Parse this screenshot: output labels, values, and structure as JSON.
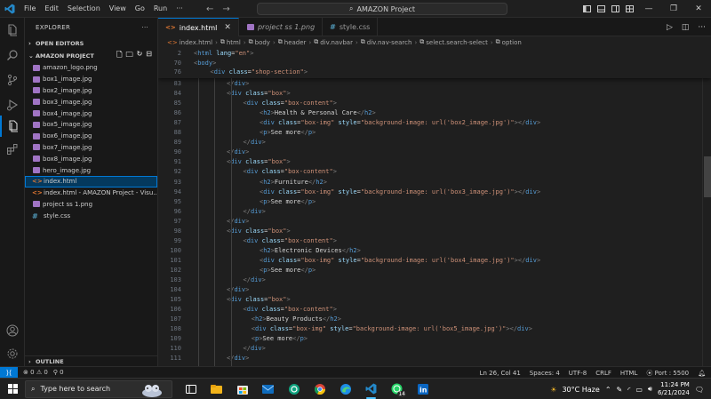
{
  "menu": [
    "File",
    "Edit",
    "Selection",
    "View",
    "Go",
    "Run",
    "···"
  ],
  "command_center": "AMAZON Project",
  "explorer": {
    "title": "EXPLORER",
    "open_editors": "OPEN EDITORS",
    "project": "AMAZON PROJECT",
    "files": [
      {
        "name": "amazon_logo.png",
        "type": "img"
      },
      {
        "name": "box1_image.jpg",
        "type": "img"
      },
      {
        "name": "box2_image.jpg",
        "type": "img"
      },
      {
        "name": "box3_image.jpg",
        "type": "img"
      },
      {
        "name": "box4_image.jpg",
        "type": "img"
      },
      {
        "name": "box5_image.jpg",
        "type": "img"
      },
      {
        "name": "box6_image.jpg",
        "type": "img"
      },
      {
        "name": "box7_image.jpg",
        "type": "img"
      },
      {
        "name": "box8_image.jpg",
        "type": "img"
      },
      {
        "name": "hero_image.jpg",
        "type": "img"
      },
      {
        "name": "index.html",
        "type": "html",
        "selected": true
      },
      {
        "name": "index.html - AMAZON Project - Visu...",
        "type": "html"
      },
      {
        "name": "project ss 1.png",
        "type": "img"
      },
      {
        "name": "style.css",
        "type": "css"
      }
    ],
    "outline": "OUTLINE"
  },
  "tabs": [
    {
      "label": "index.html",
      "active": true,
      "icon": "html"
    },
    {
      "label": "project ss 1.png",
      "active": false,
      "icon": "img"
    },
    {
      "label": "style.css",
      "active": false,
      "icon": "css"
    }
  ],
  "breadcrumb": [
    "index.html",
    "html",
    "body",
    "header",
    "div.navbar",
    "div.nav-search",
    "select.search-select",
    "option"
  ],
  "sticky_lines": [
    {
      "n": "2",
      "indent": 0,
      "html": "<span class='brk'>&lt;</span><span class='tag'>html</span> <span class='attr'>lang</span><span class='txt'>=</span><span class='str'>\"en\"</span><span class='brk'>&gt;</span>"
    },
    {
      "n": "70",
      "indent": 0,
      "html": "<span class='brk'>&lt;</span><span class='tag'>body</span><span class='brk'>&gt;</span>"
    },
    {
      "n": "76",
      "indent": 1,
      "html": "<span class='brk'>&lt;</span><span class='tag'>div</span> <span class='attr'>class</span><span class='txt'>=</span><span class='str'>\"shop-section\"</span><span class='brk'>&gt;</span>"
    }
  ],
  "code_lines": [
    {
      "n": "83",
      "indent": 2,
      "html": "<span class='brk'>&lt;/</span><span class='tag'>div</span><span class='brk'>&gt;</span>"
    },
    {
      "n": "84",
      "indent": 2,
      "html": "<span class='brk'>&lt;</span><span class='tag'>div</span> <span class='attr'>class</span><span class='txt'>=</span><span class='str'>\"box\"</span><span class='brk'>&gt;</span>"
    },
    {
      "n": "85",
      "indent": 3,
      "html": "<span class='brk'>&lt;</span><span class='tag'>div</span> <span class='attr'>class</span><span class='txt'>=</span><span class='str'>\"box-content\"</span><span class='brk'>&gt;</span>"
    },
    {
      "n": "86",
      "indent": 4,
      "html": "<span class='brk'>&lt;</span><span class='tag'>h2</span><span class='brk'>&gt;</span><span class='txt'>Health &amp; Personal Care</span><span class='brk'>&lt;/</span><span class='tag'>h2</span><span class='brk'>&gt;</span>"
    },
    {
      "n": "87",
      "indent": 4,
      "html": "<span class='brk'>&lt;</span><span class='tag'>div</span> <span class='attr'>class</span><span class='txt'>=</span><span class='str'>\"box-img\"</span> <span class='attr'>style</span><span class='txt'>=</span><span class='str'>\"background-image: url('box2_image.jpg')\"</span><span class='brk'>&gt;&lt;/</span><span class='tag'>div</span><span class='brk'>&gt;</span>"
    },
    {
      "n": "88",
      "indent": 4,
      "html": "<span class='brk'>&lt;</span><span class='tag'>p</span><span class='brk'>&gt;</span><span class='txt'>See more</span><span class='brk'>&lt;/</span><span class='tag'>p</span><span class='brk'>&gt;</span>"
    },
    {
      "n": "89",
      "indent": 3,
      "html": "<span class='brk'>&lt;/</span><span class='tag'>div</span><span class='brk'>&gt;</span>"
    },
    {
      "n": "90",
      "indent": 2,
      "html": "<span class='brk'>&lt;/</span><span class='tag'>div</span><span class='brk'>&gt;</span>"
    },
    {
      "n": "91",
      "indent": 2,
      "html": "<span class='brk'>&lt;</span><span class='tag'>div</span> <span class='attr'>class</span><span class='txt'>=</span><span class='str'>\"box\"</span><span class='brk'>&gt;</span>"
    },
    {
      "n": "92",
      "indent": 3,
      "html": "<span class='brk'>&lt;</span><span class='tag'>div</span> <span class='attr'>class</span><span class='txt'>=</span><span class='str'>\"box-content\"</span><span class='brk'>&gt;</span>"
    },
    {
      "n": "93",
      "indent": 4,
      "html": "<span class='brk'>&lt;</span><span class='tag'>h2</span><span class='brk'>&gt;</span><span class='txt'>Furniture</span><span class='brk'>&lt;/</span><span class='tag'>h2</span><span class='brk'>&gt;</span>"
    },
    {
      "n": "94",
      "indent": 4,
      "html": "<span class='brk'>&lt;</span><span class='tag'>div</span> <span class='attr'>class</span><span class='txt'>=</span><span class='str'>\"box-img\"</span> <span class='attr'>style</span><span class='txt'>=</span><span class='str'>\"background-image: url('box3_image.jpg')\"</span><span class='brk'>&gt;&lt;/</span><span class='tag'>div</span><span class='brk'>&gt;</span>"
    },
    {
      "n": "95",
      "indent": 4,
      "html": "<span class='brk'>&lt;</span><span class='tag'>p</span><span class='brk'>&gt;</span><span class='txt'>See more</span><span class='brk'>&lt;/</span><span class='tag'>p</span><span class='brk'>&gt;</span>"
    },
    {
      "n": "96",
      "indent": 3,
      "html": "<span class='brk'>&lt;/</span><span class='tag'>div</span><span class='brk'>&gt;</span>"
    },
    {
      "n": "97",
      "indent": 2,
      "html": "<span class='brk'>&lt;/</span><span class='tag'>div</span><span class='brk'>&gt;</span>"
    },
    {
      "n": "98",
      "indent": 2,
      "html": "<span class='brk'>&lt;</span><span class='tag'>div</span> <span class='attr'>class</span><span class='txt'>=</span><span class='str'>\"box\"</span><span class='brk'>&gt;</span>"
    },
    {
      "n": "99",
      "indent": 3,
      "html": "<span class='brk'>&lt;</span><span class='tag'>div</span> <span class='attr'>class</span><span class='txt'>=</span><span class='str'>\"box-content\"</span><span class='brk'>&gt;</span>"
    },
    {
      "n": "100",
      "indent": 4,
      "html": "<span class='brk'>&lt;</span><span class='tag'>h2</span><span class='brk'>&gt;</span><span class='txt'>Electronic Devices</span><span class='brk'>&lt;/</span><span class='tag'>h2</span><span class='brk'>&gt;</span>"
    },
    {
      "n": "101",
      "indent": 4,
      "html": "<span class='brk'>&lt;</span><span class='tag'>div</span> <span class='attr'>class</span><span class='txt'>=</span><span class='str'>\"box-img\"</span> <span class='attr'>style</span><span class='txt'>=</span><span class='str'>\"background-image: url('box4_image.jpg')\"</span><span class='brk'>&gt;&lt;/</span><span class='tag'>div</span><span class='brk'>&gt;</span>"
    },
    {
      "n": "102",
      "indent": 4,
      "html": "<span class='brk'>&lt;</span><span class='tag'>p</span><span class='brk'>&gt;</span><span class='txt'>See more</span><span class='brk'>&lt;/</span><span class='tag'>p</span><span class='brk'>&gt;</span>"
    },
    {
      "n": "103",
      "indent": 3,
      "html": "<span class='brk'>&lt;/</span><span class='tag'>div</span><span class='brk'>&gt;</span>"
    },
    {
      "n": "104",
      "indent": 2,
      "html": "<span class='brk'>&lt;/</span><span class='tag'>div</span><span class='brk'>&gt;</span>"
    },
    {
      "n": "105",
      "indent": 2,
      "html": "<span class='brk'>&lt;</span><span class='tag'>div</span> <span class='attr'>class</span><span class='txt'>=</span><span class='str'>\"box\"</span><span class='brk'>&gt;</span>"
    },
    {
      "n": "106",
      "indent": 3,
      "html": "<span class='brk'>&lt;</span><span class='tag'>div</span> <span class='attr'>class</span><span class='txt'>=</span><span class='str'>\"box-content\"</span><span class='brk'>&gt;</span>"
    },
    {
      "n": "107",
      "indent": 3.5,
      "html": "<span class='brk'>&lt;</span><span class='tag'>h2</span><span class='brk'>&gt;</span><span class='txt'>Beauty Products</span><span class='brk'>&lt;/</span><span class='tag'>h2</span><span class='brk'>&gt;</span>"
    },
    {
      "n": "108",
      "indent": 3.5,
      "html": "<span class='brk'>&lt;</span><span class='tag'>div</span> <span class='attr'>class</span><span class='txt'>=</span><span class='str'>\"box-img\"</span> <span class='attr'>style</span><span class='txt'>=</span><span class='str'>\"background-image: url('box5_image.jpg')\"</span><span class='brk'>&gt;&lt;/</span><span class='tag'>div</span><span class='brk'>&gt;</span>"
    },
    {
      "n": "109",
      "indent": 3.5,
      "html": "<span class='brk'>&lt;</span><span class='tag'>p</span><span class='brk'>&gt;</span><span class='txt'>See more</span><span class='brk'>&lt;/</span><span class='tag'>p</span><span class='brk'>&gt;</span>"
    },
    {
      "n": "110",
      "indent": 3,
      "html": "<span class='brk'>&lt;/</span><span class='tag'>div</span><span class='brk'>&gt;</span>"
    },
    {
      "n": "111",
      "indent": 2,
      "html": "<span class='brk'>&lt;/</span><span class='tag'>div</span><span class='brk'>&gt;</span>"
    }
  ],
  "status": {
    "errors": "0",
    "warnings": "0",
    "ports": "0",
    "position": "Ln 26, Col 41",
    "spaces": "Spaces: 4",
    "encoding": "UTF-8",
    "eol": "CRLF",
    "language": "HTML",
    "port": "Port : 5500"
  },
  "taskbar": {
    "search_placeholder": "Type here to search",
    "weather": "30°C  Haze",
    "time": "11:24 PM",
    "date": "6/21/2024",
    "whatsapp_badge": "14"
  },
  "colors": {
    "accent": "#0078d4",
    "html_icon": "#e37933",
    "css_icon": "#519aba"
  }
}
